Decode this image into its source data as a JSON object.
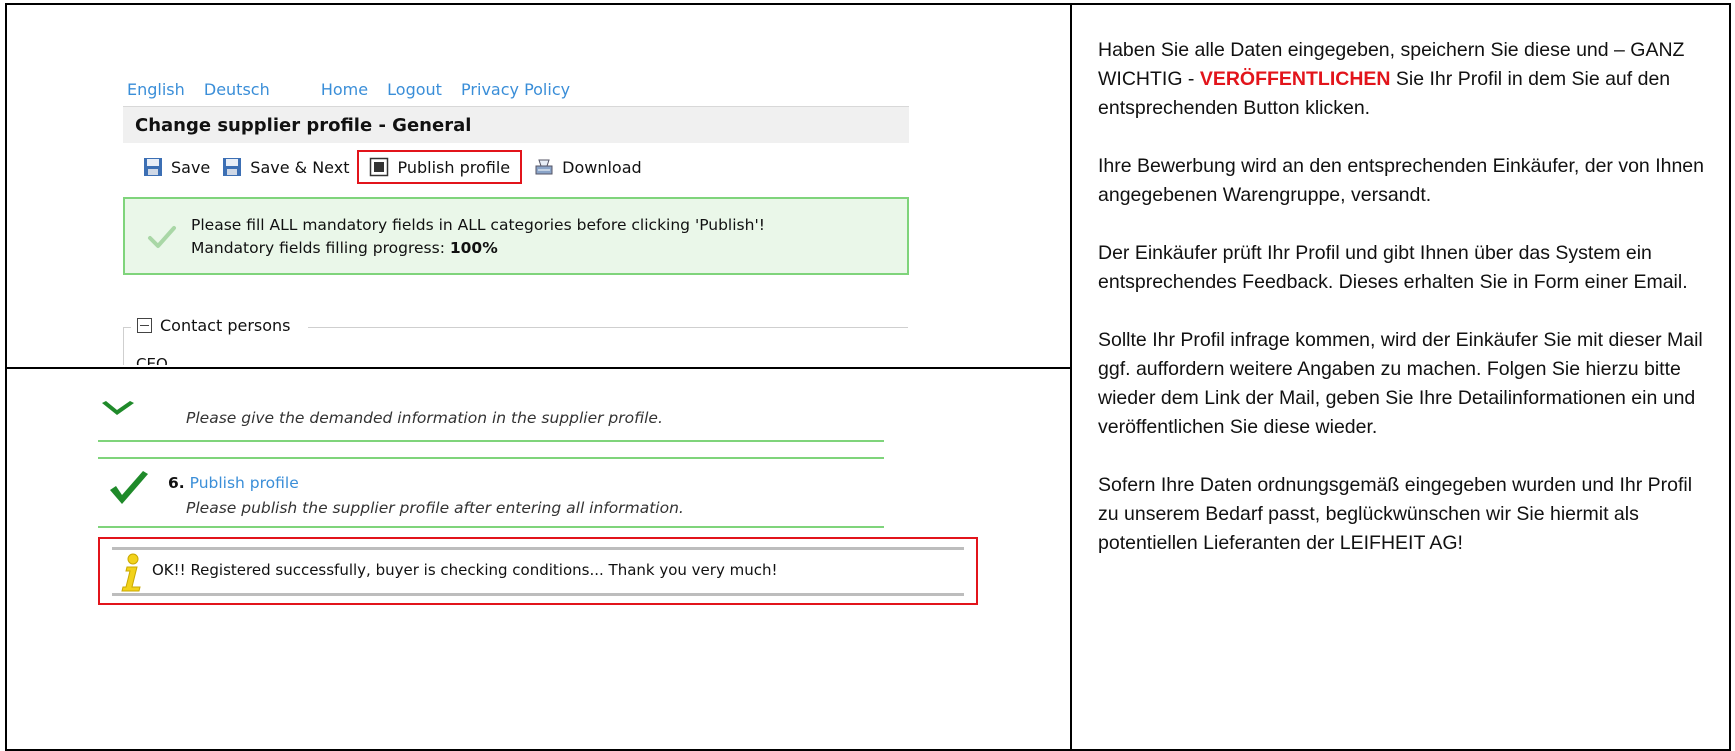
{
  "top_screenshot": {
    "nav_links": [
      "English",
      "Deutsch",
      "Home",
      "Logout",
      "Privacy Policy"
    ],
    "page_title": "Change supplier profile - General",
    "toolbar": {
      "save": "Save",
      "save_next": "Save & Next",
      "publish": "Publish profile",
      "download": "Download"
    },
    "notice": {
      "line1": "Please fill ALL mandatory fields in ALL categories before clicking 'Publish'!",
      "line2_label": "Mandatory fields filling progress: ",
      "line2_value": "100%"
    },
    "fieldset": {
      "legend": "Contact persons",
      "first_field": "CEO"
    }
  },
  "bottom_screenshot": {
    "step5_text": "Please give the demanded information in the supplier profile.",
    "step6_number": "6.",
    "step6_title": "Publish profile",
    "step6_text": "Please publish the supplier profile after entering all information.",
    "ok_message": "OK!! Registered successfully, buyer is checking conditions... Thank you very much!"
  },
  "instructions": {
    "p1_before": "Haben Sie alle Daten eingegeben, speichern Sie diese und – GANZ WICHTIG - ",
    "p1_highlight": "VERÖFFENTLICHEN",
    "p1_after": " Sie Ihr Profil in dem Sie auf den entsprechenden Button klicken.",
    "p2": "Ihre Bewerbung wird an den entsprechenden Einkäufer, der von Ihnen angegebenen Warengruppe, versandt.",
    "p3": "Der Einkäufer prüft Ihr Profil und gibt Ihnen über das System ein entsprechendes Feedback. Dieses erhalten Sie in Form einer Email.",
    "p4": "Sollte Ihr Profil infrage kommen, wird der Einkäufer Sie mit dieser Mail ggf. auffordern weitere Angaben zu machen. Folgen Sie hierzu bitte wieder dem Link der Mail, geben Sie Ihre Detailinformationen ein und veröffentlichen Sie diese wieder.",
    "p5": "Sofern Ihre Daten ordnungsgemäß eingegeben wurden und Ihr Profil zu unserem Bedarf passt, beglückwünschen wir Sie hiermit als potentiellen Lieferanten der LEIFHEIT AG!"
  },
  "colors": {
    "link": "#3a8ed8",
    "highlight_red": "#e2141b",
    "success_green": "#7fd47b",
    "check_green": "#1f8a2a"
  }
}
